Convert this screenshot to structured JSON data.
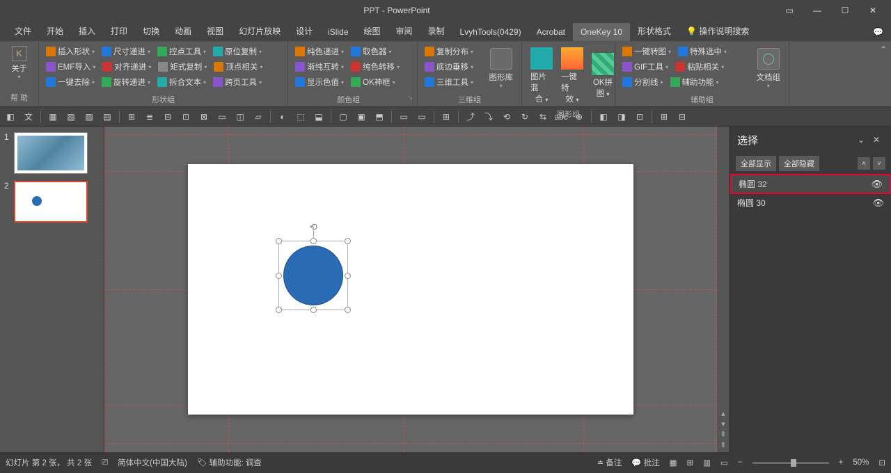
{
  "title": "PPT - PowerPoint",
  "tabs": [
    "文件",
    "开始",
    "插入",
    "打印",
    "切换",
    "动画",
    "视图",
    "幻灯片放映",
    "设计",
    "iSlide",
    "绘图",
    "审阅",
    "录制",
    "LvyhTools(0429)",
    "Acrobat",
    "OneKey 10",
    "形状格式"
  ],
  "active_tab": 15,
  "help_search": "操作说明搜索",
  "ribbon_left": {
    "logo": "K",
    "about": "关于",
    "help": "帮 助"
  },
  "group_shape": {
    "label": "形状组",
    "r1": [
      "插入形状",
      "尺寸递进",
      "控点工具",
      "原位复制"
    ],
    "r2": [
      "EMF导入",
      "对齐递进",
      "矩式复制",
      "顶点相关"
    ],
    "r3": [
      "一键去除",
      "旋转递进",
      "拆合文本",
      "跨页工具"
    ]
  },
  "group_color": {
    "label": "颜色组",
    "r1": [
      "纯色递进",
      "取色器"
    ],
    "r2": [
      "渐纯互转",
      "纯色转移"
    ],
    "r3": [
      "显示色值",
      "OK神框"
    ]
  },
  "group_3d": {
    "label": "三维组",
    "r1": [
      "复制分布"
    ],
    "r2": [
      "底边垂移"
    ],
    "r3": [
      "三维工具"
    ],
    "big": "图形库"
  },
  "group_graphic": {
    "label": "图形组",
    "big1a": "图片混",
    "big1b": "合",
    "big2a": "一键特",
    "big2b": "效",
    "big3a": "OK拼",
    "big3b": "图"
  },
  "group_aux": {
    "label": "辅助组",
    "r1": [
      "一键转图",
      "特殊选中"
    ],
    "r2": [
      "GIF工具",
      "粘贴相关"
    ],
    "r3": [
      "分割线",
      "辅助功能"
    ],
    "big": "文档组"
  },
  "selection": {
    "title": "选择",
    "show_all": "全部显示",
    "hide_all": "全部隐藏",
    "items": [
      {
        "name": "椭圆 32",
        "highlighted": true
      },
      {
        "name": "椭圆 30",
        "highlighted": false
      }
    ]
  },
  "thumbs": [
    1,
    2
  ],
  "status": {
    "slide_info": "幻灯片 第 2 张， 共 2 张",
    "lang": "简体中文(中国大陆)",
    "a11y": "辅助功能: 调查",
    "notes": "备注",
    "comments": "批注",
    "zoom": "50%"
  }
}
